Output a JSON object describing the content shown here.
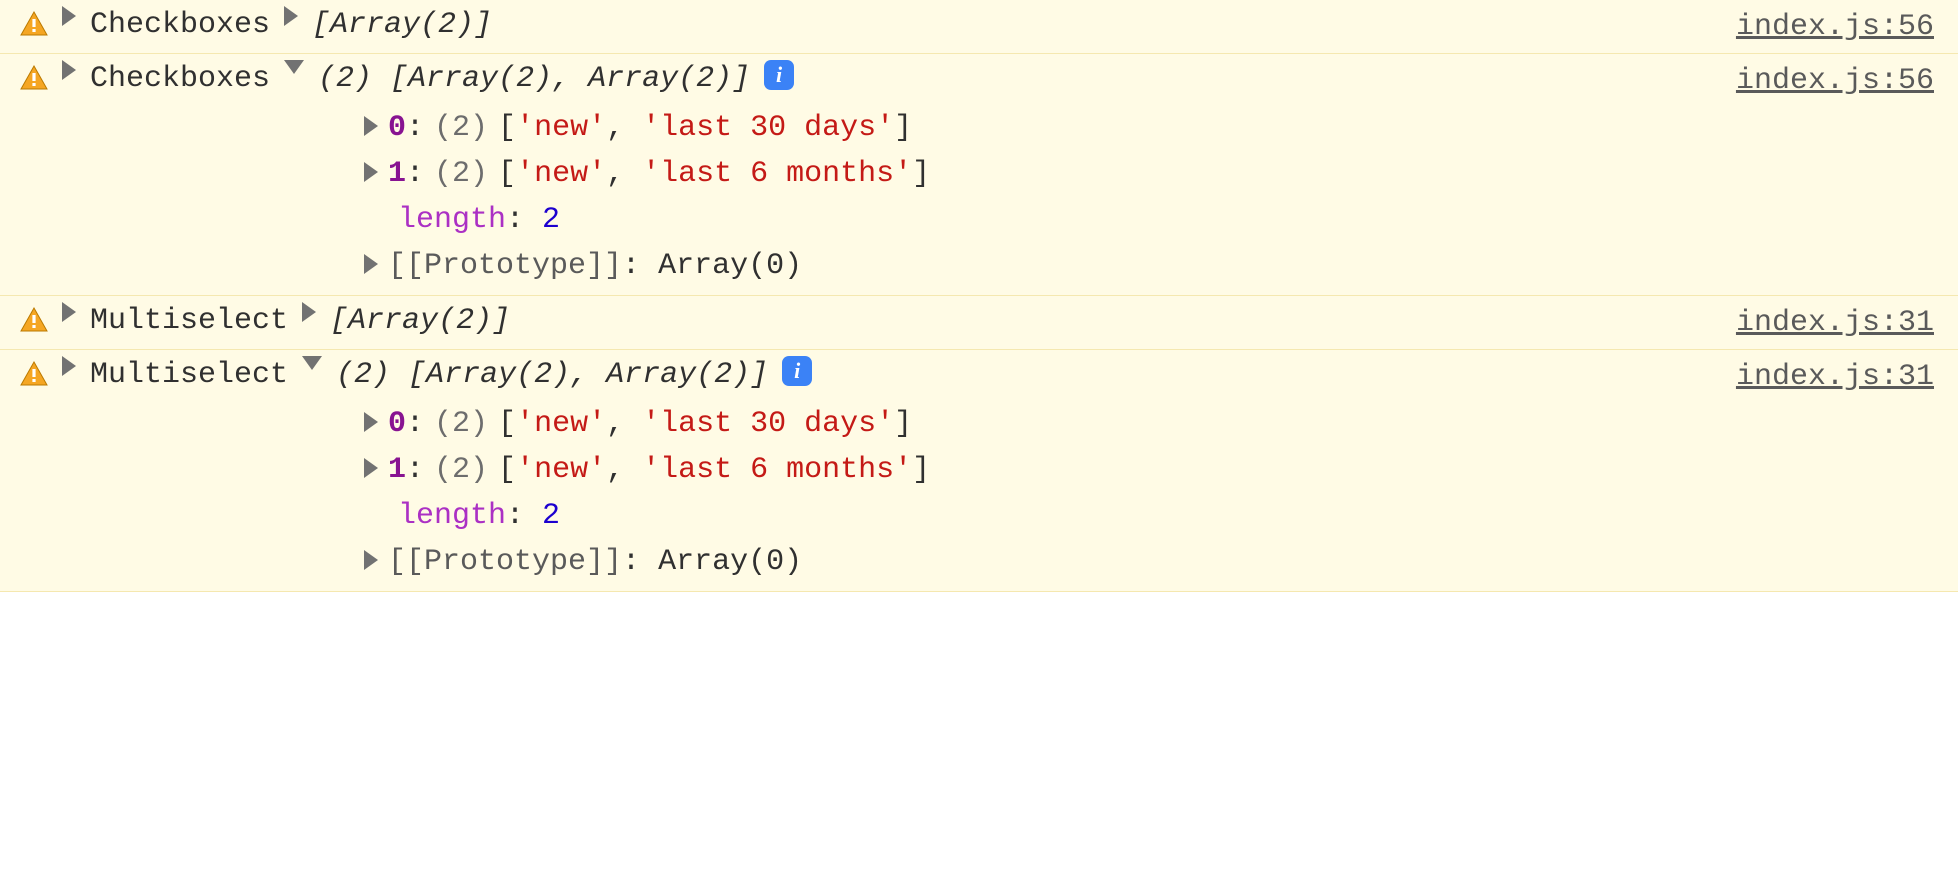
{
  "rows": [
    {
      "label": "Checkboxes",
      "preview": "[Array(2)]",
      "src": "index.js:56",
      "expanded": false
    },
    {
      "label": "Checkboxes",
      "preview": "(2) [Array(2), Array(2)]",
      "src": "index.js:56",
      "expanded": true,
      "items": [
        {
          "idx": "0",
          "count": "(2)",
          "vals": [
            "'new'",
            "'last 30 days'"
          ]
        },
        {
          "idx": "1",
          "count": "(2)",
          "vals": [
            "'new'",
            "'last 6 months'"
          ]
        }
      ],
      "lengthKey": "length",
      "lengthVal": "2",
      "proto": "[[Prototype]]",
      "protoVal": "Array(0)"
    },
    {
      "label": "Multiselect",
      "preview": "[Array(2)]",
      "src": "index.js:31",
      "expanded": false
    },
    {
      "label": "Multiselect",
      "preview": "(2) [Array(2), Array(2)]",
      "src": "index.js:31",
      "expanded": true,
      "items": [
        {
          "idx": "0",
          "count": "(2)",
          "vals": [
            "'new'",
            "'last 30 days'"
          ]
        },
        {
          "idx": "1",
          "count": "(2)",
          "vals": [
            "'new'",
            "'last 6 months'"
          ]
        }
      ],
      "lengthKey": "length",
      "lengthVal": "2",
      "proto": "[[Prototype]]",
      "protoVal": "Array(0)"
    }
  ],
  "infoGlyph": "i"
}
